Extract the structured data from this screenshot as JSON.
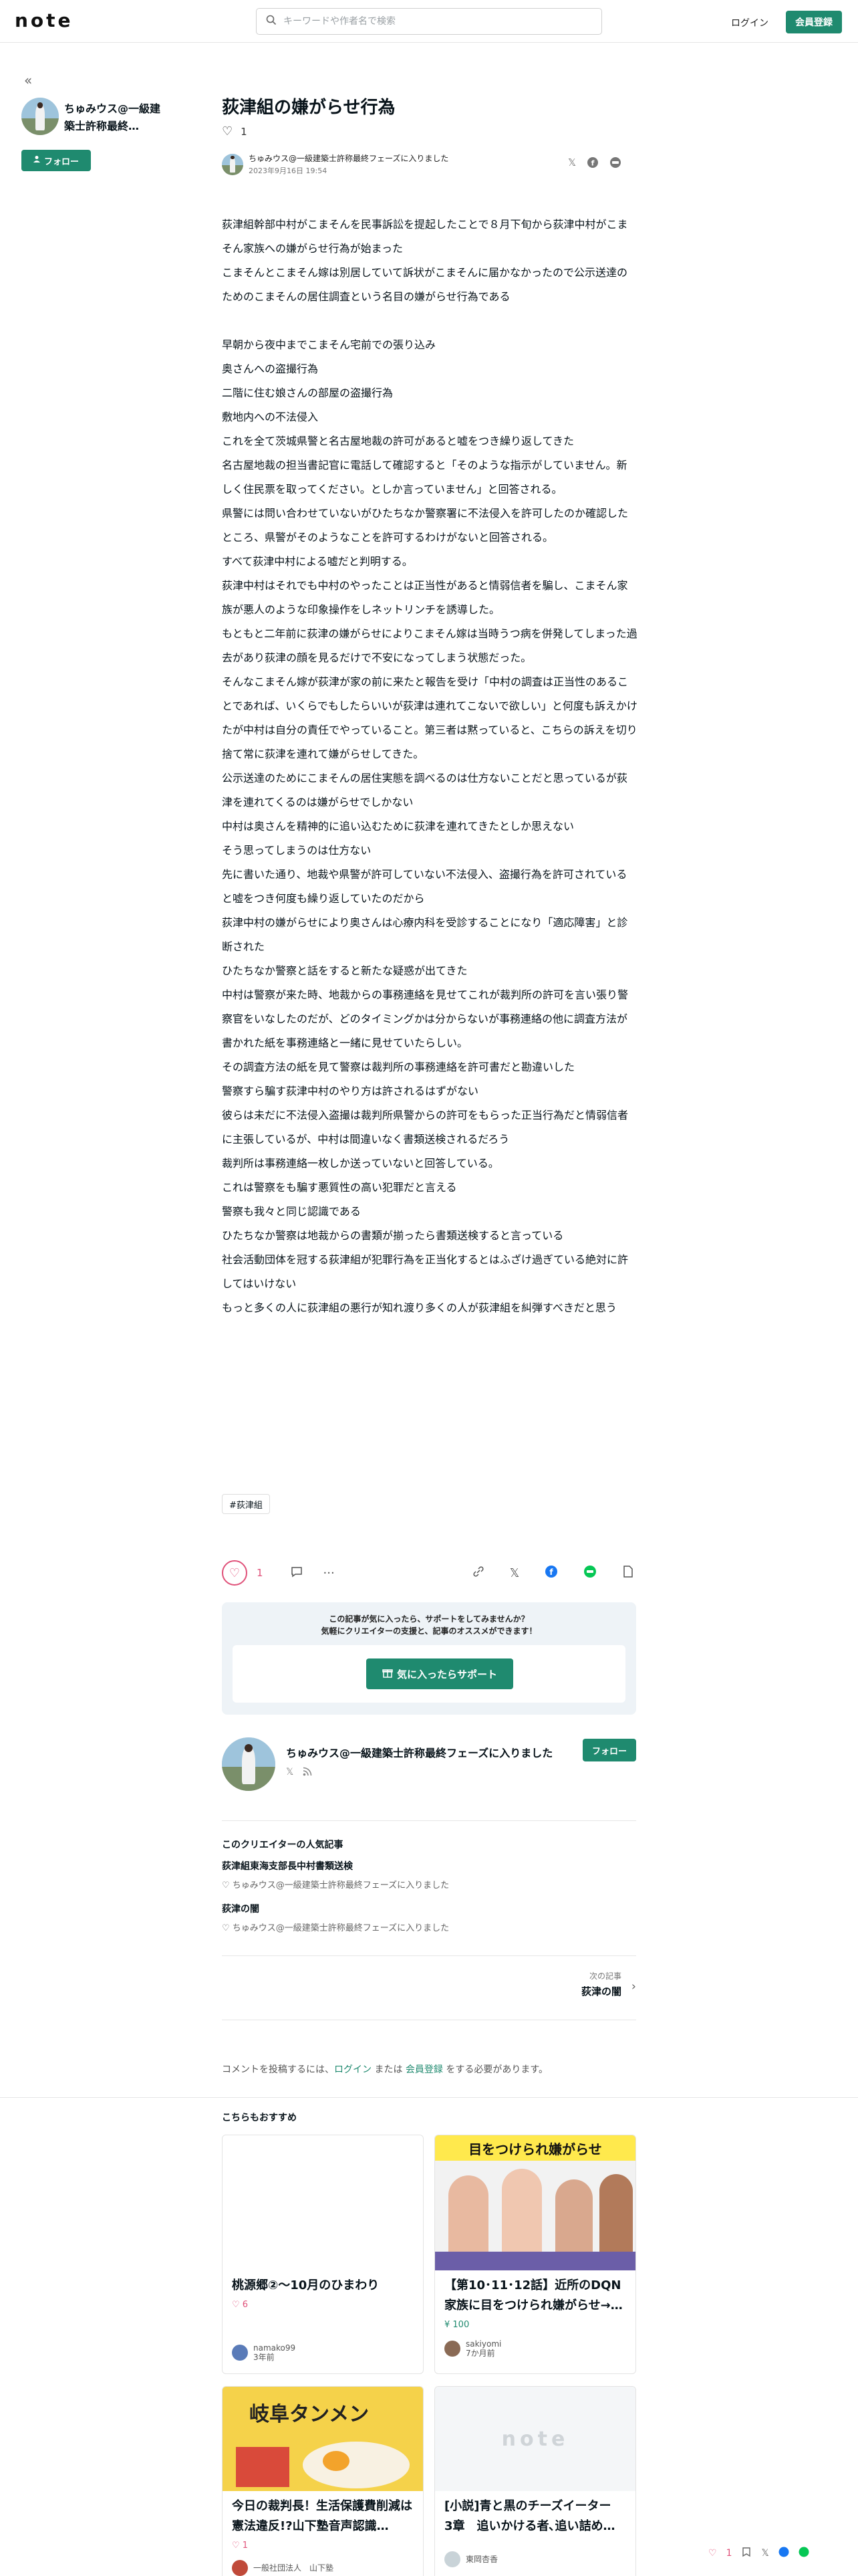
{
  "header": {
    "logo": "note",
    "search_placeholder": "キーワードや作者名で検索",
    "login": "ログイン",
    "signup": "会員登録"
  },
  "sidebar": {
    "author_name": "ちゅみウス@一級建築士許称最終…",
    "follow": "フォロー"
  },
  "article": {
    "title": "荻津組の嫌がらせ行為",
    "like_count": "1",
    "author": "ちゅみウス@一級建築士許称最終フェーズに入りました",
    "date": "2023年9月16日 19:54",
    "paragraphs": [
      "荻津組幹部中村がこまそんを民事訴訟を提起したことで８月下旬から荻津中村がこまそん家族への嫌がらせ行為が始まった",
      "こまそんとこまそん嫁は別居していて訴状がこまそんに届かなかったので公示送達のためのこまそんの居住調査という名目の嫌がらせ行為である",
      "",
      "早朝から夜中までこまそん宅前での張り込み",
      "奥さんへの盗撮行為",
      "二階に住む娘さんの部屋の盗撮行為",
      "敷地内への不法侵入",
      "これを全て茨城県警と名古屋地裁の許可があると嘘をつき繰り返してきた",
      "名古屋地裁の担当書記官に電話して確認すると「そのような指示がしていません。新しく住民票を取ってください。としか言っていません」と回答される。",
      "県警には問い合わせていないがひたちなか警察署に不法侵入を許可したのか確認したところ、県警がそのようなことを許可するわけがないと回答される。",
      "すべて荻津中村による嘘だと判明する。",
      "荻津中村はそれでも中村のやったことは正当性があると情弱信者を騙し、こまそん家族が悪人のような印象操作をしネットリンチを誘導した。",
      "もともと二年前に荻津の嫌がらせによりこまそん嫁は当時うつ病を併発してしまった過去があり荻津の顔を見るだけで不安になってしまう状態だった。",
      "そんなこまそん嫁が荻津が家の前に来たと報告を受け「中村の調査は正当性のあることであれば、いくらでもしたらいいが荻津は連れてこないで欲しい」と何度も訴えかけたが中村は自分の責任でやっていること。第三者は黙っていると、こちらの訴えを切り捨て常に荻津を連れて嫌がらせしてきた。",
      "公示送達のためにこまそんの居住実態を調べるのは仕方ないことだと思っているが荻津を連れてくるのは嫌がらせでしかない",
      "中村は奥さんを精神的に追い込むために荻津を連れてきたとしか思えない",
      "そう思ってしまうのは仕方ない",
      "先に書いた通り、地裁や県警が許可していない不法侵入、盗撮行為を許可されていると嘘をつき何度も繰り返していたのだから",
      "荻津中村の嫌がらせにより奥さんは心療内科を受診することになり「適応障害」と診断された",
      "ひたちなか警察と話をすると新たな疑惑が出てきた",
      "中村は警察が来た時、地裁からの事務連絡を見せてこれが裁判所の許可を言い張り警察官をいなしたのだが、どのタイミングかは分からないが事務連絡の他に調査方法が書かれた紙を事務連絡と一緒に見せていたらしい。",
      "その調査方法の紙を見て警察は裁判所の事務連絡を許可書だと勘違いした",
      "警察すら騙す荻津中村のやり方は許されるはずがない",
      "彼らは未だに不法侵入盗撮は裁判所県警からの許可をもらった正当行為だと情弱信者に主張しているが、中村は間違いなく書類送検されるだろう",
      "裁判所は事務連絡一枚しか送っていないと回答している。",
      "これは警察をも騙す悪質性の高い犯罪だと言える",
      "警察も我々と同じ認識である",
      "ひたちなか警察は地裁からの書類が揃ったら書類送検すると言っている",
      "社会活動団体を冠する荻津組が犯罪行為を正当化するとはふざけ過ぎている絶対に許してはいけない",
      "もっと多くの人に荻津組の悪行が知れ渡り多くの人が荻津組を糾弾すべきだと思う"
    ],
    "tag": "#荻津組",
    "action_like_count": "1"
  },
  "support": {
    "line1": "この記事が気に入ったら、サポートをしてみませんか？",
    "line2": "気軽にクリエイターの支援と、記事のオススメができます！",
    "button": "気に入ったらサポート"
  },
  "creator": {
    "name": "ちゅみウス@一級建築士許称最終フェーズに入りました",
    "follow": "フォロー"
  },
  "popular": {
    "heading": "このクリエイターの人気記事",
    "items": [
      {
        "title": "荻津組東海支部長中村書類送検",
        "author": "ちゅみウス@一級建築士許称最終フェーズに入りました"
      },
      {
        "title": "荻津の闇",
        "author": "ちゅみウス@一級建築士許称最終フェーズに入りました"
      }
    ]
  },
  "next": {
    "label": "次の記事",
    "title": "荻津の闇"
  },
  "comment": {
    "prefix": "コメントを投稿するには、",
    "login": "ログイン",
    "middle": " または ",
    "signup": "会員登録",
    "suffix": " をする必要があります。"
  },
  "recommend": {
    "heading": "こちらもおすすめ",
    "cards": [
      {
        "title": "桃源郷②〜10月のひまわり",
        "like": "6",
        "author": "namako99",
        "time": "3年前"
      },
      {
        "title": "【第10･11･12話】近所のDQN家族に目をつけられ嫌がらせ→…",
        "price": "¥ 100",
        "author": "sakiyomi",
        "time": "7か月前",
        "img_text": "目をつけられ嫌がらせ"
      },
      {
        "title": "今日の裁判長！生活保護費削減は憲法違反!?山下塾音声認識…",
        "like": "1",
        "author": "一般社団法人　山下塾",
        "time": "",
        "img_text": "岐阜タンメン"
      },
      {
        "title": "[小説]青と黒のチーズイーター　3章　追いかける者､追い詰め…",
        "author": "東岡杏香",
        "time": "",
        "img_text": "note"
      }
    ]
  },
  "footer_bar": {
    "like_count": "1"
  },
  "colors": {
    "brand": "#1f8a6f",
    "like": "#e0527a"
  }
}
